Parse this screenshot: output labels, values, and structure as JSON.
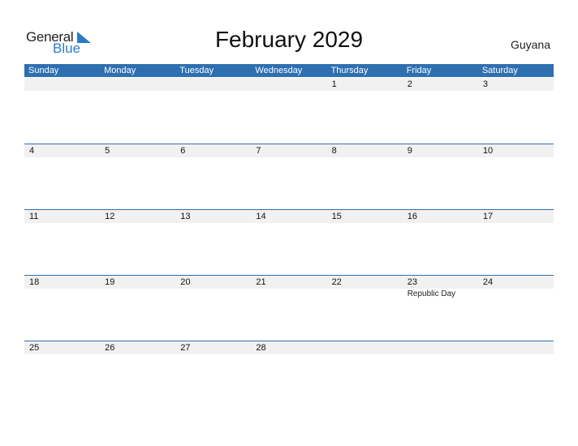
{
  "logo": {
    "word1": "General",
    "word2": "Blue"
  },
  "title": "February 2029",
  "country": "Guyana",
  "colors": {
    "accent": "#2e6fb0",
    "logo_blue": "#2a7cc7",
    "date_row_bg": "#f1f1f1"
  },
  "weekdays": [
    "Sunday",
    "Monday",
    "Tuesday",
    "Wednesday",
    "Thursday",
    "Friday",
    "Saturday"
  ],
  "weeks": [
    {
      "days": [
        "",
        "",
        "",
        "",
        "1",
        "2",
        "3"
      ],
      "events": [
        "",
        "",
        "",
        "",
        "",
        "",
        ""
      ]
    },
    {
      "days": [
        "4",
        "5",
        "6",
        "7",
        "8",
        "9",
        "10"
      ],
      "events": [
        "",
        "",
        "",
        "",
        "",
        "",
        ""
      ]
    },
    {
      "days": [
        "11",
        "12",
        "13",
        "14",
        "15",
        "16",
        "17"
      ],
      "events": [
        "",
        "",
        "",
        "",
        "",
        "",
        ""
      ]
    },
    {
      "days": [
        "18",
        "19",
        "20",
        "21",
        "22",
        "23",
        "24"
      ],
      "events": [
        "",
        "",
        "",
        "",
        "",
        "Republic Day",
        ""
      ]
    },
    {
      "days": [
        "25",
        "26",
        "27",
        "28",
        "",
        "",
        ""
      ],
      "events": [
        "",
        "",
        "",
        "",
        "",
        "",
        ""
      ]
    }
  ]
}
